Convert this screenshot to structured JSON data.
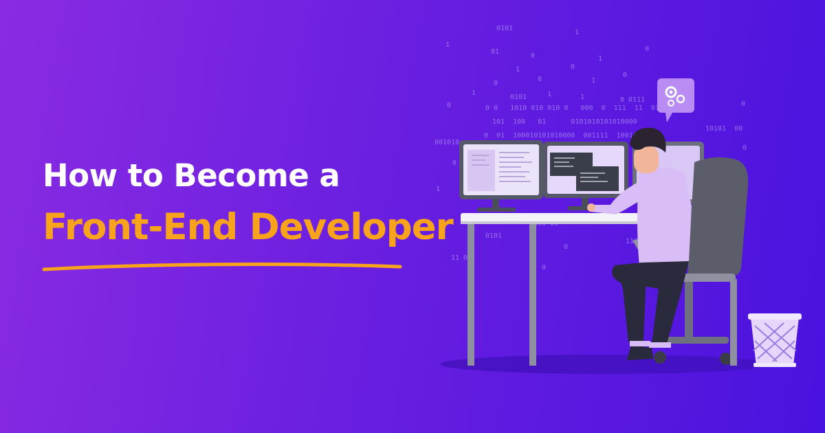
{
  "headline": {
    "line1": "How to Become a",
    "line2": "Front-End Developer"
  },
  "colors": {
    "background_start": "#8a2be2",
    "background_end": "#4a12df",
    "headline_white": "#ffffff",
    "headline_accent": "#f7a31c",
    "underline": "#f7a31c"
  },
  "binary_rain": [
    "0101",
    "1",
    "0",
    "01",
    "1",
    "0",
    "1",
    "0",
    "1",
    "0",
    "0",
    "1",
    "0",
    "0101",
    "1",
    "1",
    "1",
    "0 0111",
    "0",
    "0 0   1010 010 010 0   000  0  111  11  01",
    "101  100   01      0101010101010000",
    "0  01  100010101010000  001111  100101  110",
    "001010",
    "0",
    "1",
    "0",
    "10101  00",
    "0",
    "0101",
    "0",
    "11 01",
    "0",
    "1000 00",
    "110"
  ],
  "icons": {
    "illustration": "developer-at-desk-illustration",
    "gear": "gear-icon",
    "trash": "trash-bin-icon"
  }
}
